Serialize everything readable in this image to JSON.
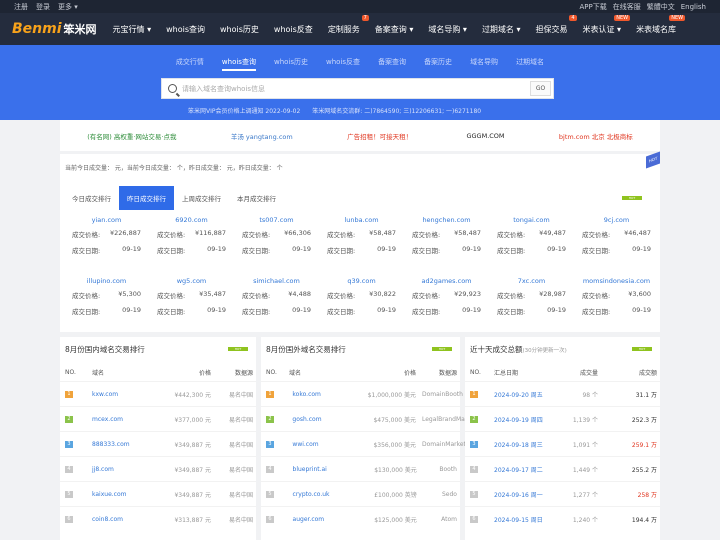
{
  "topbar": {
    "left": [
      "注册",
      "登录",
      "更多 ▾"
    ],
    "right": [
      "APP下载",
      "在线客服",
      "繁體中文",
      "English"
    ]
  },
  "brand": {
    "en": "Benmi",
    "cn": "笨米网"
  },
  "nav": [
    {
      "label": "元宝行情 ▾",
      "badge": ""
    },
    {
      "label": "whois查询",
      "badge": ""
    },
    {
      "label": "whois历史",
      "badge": ""
    },
    {
      "label": "whois反查",
      "badge": ""
    },
    {
      "label": "定制服务",
      "badge": "7"
    },
    {
      "label": "备案查询 ▾",
      "badge": ""
    },
    {
      "label": "域名导购 ▾",
      "badge": ""
    },
    {
      "label": "过期域名 ▾",
      "badge": ""
    },
    {
      "label": "担保交易",
      "badge": "4"
    },
    {
      "label": "米表认证 ▾",
      "badge": "NEW"
    },
    {
      "label": "米表域名库",
      "badge": "NEW"
    }
  ],
  "search_tabs": [
    "成交行情",
    "whois查询",
    "whois历史",
    "whois反查",
    "备案查询",
    "备案历史",
    "域名导购",
    "过期域名"
  ],
  "search_active": 1,
  "search": {
    "placeholder": "请输入域名查询whois信息",
    "button": "GO"
  },
  "notices": [
    "笨米网VIP会员价格上调通知 2022-09-02",
    "笨米网域名交流群: 二)7864590; 三)12206631; 一)6271180"
  ],
  "ads": [
    {
      "text": "(有名网) 高权重·网站交易·点我",
      "color": "g"
    },
    {
      "text": "羊汤 yangtang.com",
      "color": "b"
    },
    {
      "text": "广告招租！可接天租！",
      "color": "r"
    },
    {
      "text": "GGGM.COM",
      "color": "k"
    },
    {
      "text": "bjtm.com 北京 北极商标",
      "color": "r"
    }
  ],
  "stat": {
    "text": "当前今日成交量：   元，当前今日成交量：   个，昨日成交量：   元，昨日成交量：   个",
    "ribbon": "HOT"
  },
  "rank_tabs": [
    "今日成交排行",
    "昨日成交排行",
    "上周成交排行",
    "本月成交排行"
  ],
  "rank_active": 1,
  "hot_label": "HOT",
  "price_label": "成交价格:",
  "date_label": "成交日期:",
  "deals": [
    {
      "domain": "yian.com",
      "price": "¥226,887",
      "date": "09-19"
    },
    {
      "domain": "6920.com",
      "price": "¥116,887",
      "date": "09-19"
    },
    {
      "domain": "ts007.com",
      "price": "¥66,306",
      "date": "09-19"
    },
    {
      "domain": "lunba.com",
      "price": "¥58,487",
      "date": "09-19"
    },
    {
      "domain": "hengchen.com",
      "price": "¥58,487",
      "date": "09-19"
    },
    {
      "domain": "tongai.com",
      "price": "¥49,487",
      "date": "09-19"
    },
    {
      "domain": "9cj.com",
      "price": "¥46,487",
      "date": "09-19"
    },
    {
      "domain": "illupino.com",
      "price": "¥5,300",
      "date": "09-19"
    },
    {
      "domain": "wg5.com",
      "price": "¥35,487",
      "date": "09-19"
    },
    {
      "domain": "simichael.com",
      "price": "¥4,488",
      "date": "09-19"
    },
    {
      "domain": "q39.com",
      "price": "¥30,822",
      "date": "09-19"
    },
    {
      "domain": "ad2games.com",
      "price": "¥29,923",
      "date": "09-19"
    },
    {
      "domain": "7xc.com",
      "price": "¥28,987",
      "date": "09-19"
    },
    {
      "domain": "momsindonesia.com",
      "price": "¥3,600",
      "date": "09-19"
    }
  ],
  "panels": [
    {
      "title": "8月份国内域名交易排行",
      "cols": [
        "NO.",
        "域名",
        "价格",
        "数据源"
      ],
      "rows": [
        [
          "1",
          "kxw.com",
          "¥442,300 元",
          "易名中国"
        ],
        [
          "2",
          "mcex.com",
          "¥377,000 元",
          "易名中国"
        ],
        [
          "3",
          "888333.com",
          "¥349,887 元",
          "易名中国"
        ],
        [
          "4",
          "jj8.com",
          "¥349,887 元",
          "易名中国"
        ],
        [
          "5",
          "kaixue.com",
          "¥349,887 元",
          "易名中国"
        ],
        [
          "6",
          "coin8.com",
          "¥313,887 元",
          "易名中国"
        ]
      ]
    },
    {
      "title": "8月份国外域名交易排行",
      "cols": [
        "NO.",
        "域名",
        "价格",
        "数据源"
      ],
      "rows": [
        [
          "1",
          "koko.com",
          "$1,000,000 美元",
          "DomainBooth"
        ],
        [
          "2",
          "gosh.com",
          "$475,000 美元",
          "LegalBrandMa..."
        ],
        [
          "3",
          "wwi.com",
          "$356,000 美元",
          "DomainMarket"
        ],
        [
          "4",
          "blueprint.ai",
          "$130,000 美元",
          "Booth"
        ],
        [
          "5",
          "crypto.co.uk",
          "£100,000 英镑",
          "Sedo"
        ],
        [
          "6",
          "auger.com",
          "$125,000 美元",
          "Atom"
        ]
      ]
    },
    {
      "title": "近十天成交总额",
      "subtitle": "(30分钟更新一次)",
      "cols": [
        "NO.",
        "汇总日期",
        "成交量",
        "成交额"
      ],
      "rows": [
        [
          "1",
          "2024-09-20 周五",
          "98 个",
          "31.1 万"
        ],
        [
          "2",
          "2024-09-19 周四",
          "1,139 个",
          "252.3 万"
        ],
        [
          "3",
          "2024-09-18 周三",
          "1,091 个",
          "259.1 万"
        ],
        [
          "4",
          "2024-09-17 周二",
          "1,449 个",
          "255.2 万"
        ],
        [
          "5",
          "2024-09-16 周一",
          "1,277 个",
          "258 万"
        ],
        [
          "6",
          "2024-09-15 周日",
          "1,240 个",
          "194.4 万"
        ]
      ]
    }
  ]
}
